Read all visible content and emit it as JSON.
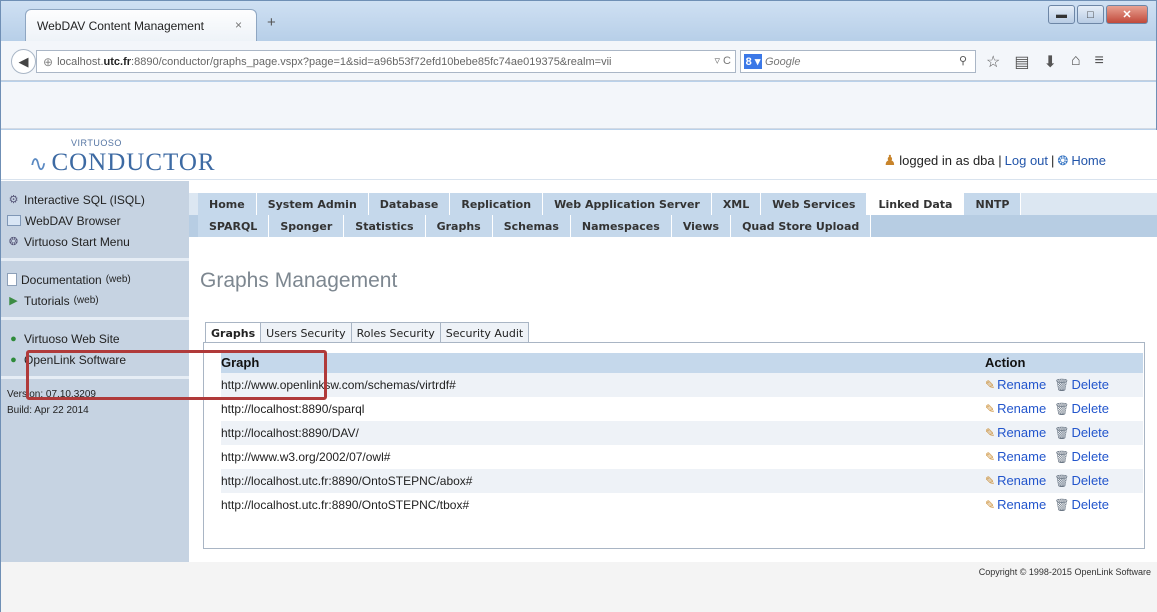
{
  "browser": {
    "tab_title": "WebDAV Content Management",
    "tab_close": "×",
    "new_tab": "+",
    "url_prefix": "localhost.",
    "url_domain": "utc.fr",
    "url_rest": ":8890/conductor/graphs_page.vspx?page=1&sid=a96b53f72efd10bebe85fc74ae019375&realm=vii",
    "url_tail": "▿ C",
    "search_engine": "8 ▾",
    "search_placeholder": "Google",
    "win_min": "▬",
    "win_max": "□",
    "win_close": "✕"
  },
  "header": {
    "logo_small": "VIRTUOSO",
    "logo_big": "CONDUCTOR",
    "logged_in_text": "logged in as dba |",
    "logout": "Log out",
    "separator": "|",
    "home": "Home"
  },
  "sidebar": {
    "group1": [
      "Interactive SQL (ISQL)",
      "WebDAV Browser",
      "Virtuoso Start Menu"
    ],
    "documentation": "Documentation",
    "documentation_suffix": "(web)",
    "tutorials": "Tutorials",
    "tutorials_suffix": "(web)",
    "group3": [
      "Virtuoso Web Site",
      "OpenLink Software"
    ],
    "version": "Version: 07.10.3209",
    "build": "Build: Apr 22 2014"
  },
  "nav": {
    "row1": [
      "Home",
      "System Admin",
      "Database",
      "Replication",
      "Web Application Server",
      "XML",
      "Web Services",
      "Linked Data",
      "NNTP"
    ],
    "row2": [
      "SPARQL",
      "Sponger",
      "Statistics",
      "Graphs",
      "Schemas",
      "Namespaces",
      "Views",
      "Quad Store Upload"
    ]
  },
  "page_title": "Graphs Management",
  "subtabs": [
    "Graphs",
    "Users Security",
    "Roles Security",
    "Security Audit"
  ],
  "table": {
    "col_graph": "Graph",
    "col_action": "Action",
    "rename_label": "Rename",
    "delete_label": "Delete",
    "rows": [
      "http://www.openlinksw.com/schemas/virtrdf#",
      "http://localhost:8890/sparql",
      "http://localhost:8890/DAV/",
      "http://www.w3.org/2002/07/owl#",
      "http://localhost.utc.fr:8890/OntoSTEPNC/abox#",
      "http://localhost.utc.fr:8890/OntoSTEPNC/tbox#"
    ]
  },
  "copyright": "Copyright © 1998-2015 OpenLink Software"
}
